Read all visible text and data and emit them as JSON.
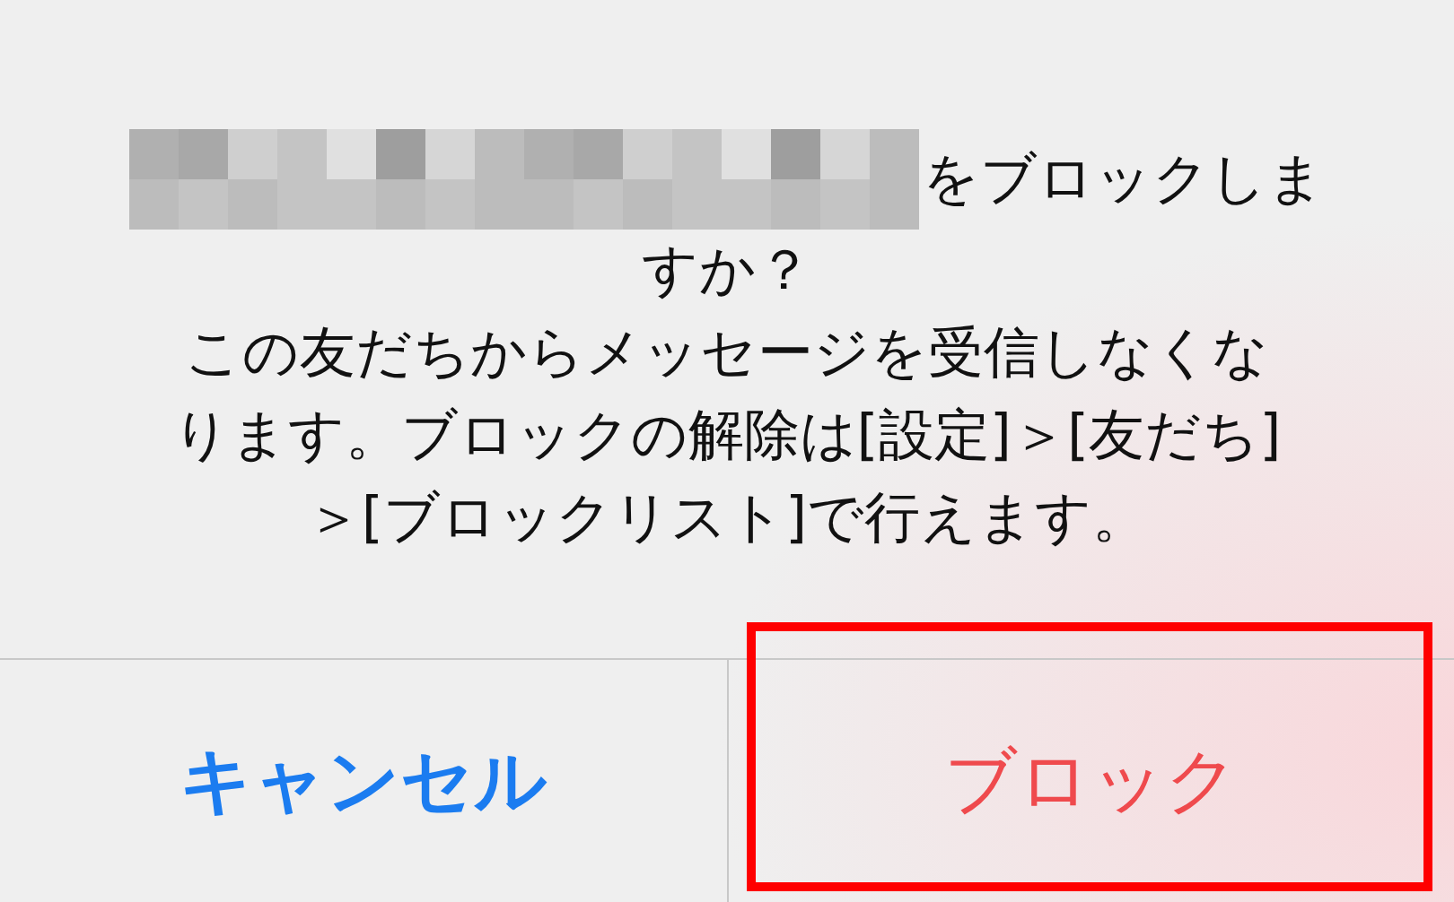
{
  "alert": {
    "message_lines": [
      "をブロックしま",
      "すか？",
      "この友だちからメッセージを受信しなくな",
      "ります。ブロックの解除は[設定]＞[友だち]",
      "＞[ブロックリスト]で行えます。"
    ]
  },
  "buttons": [
    {
      "label": "キャンセル",
      "kind": "cancel",
      "highlighted": false
    },
    {
      "label": "ブロック",
      "kind": "destructive",
      "highlighted": true
    }
  ]
}
